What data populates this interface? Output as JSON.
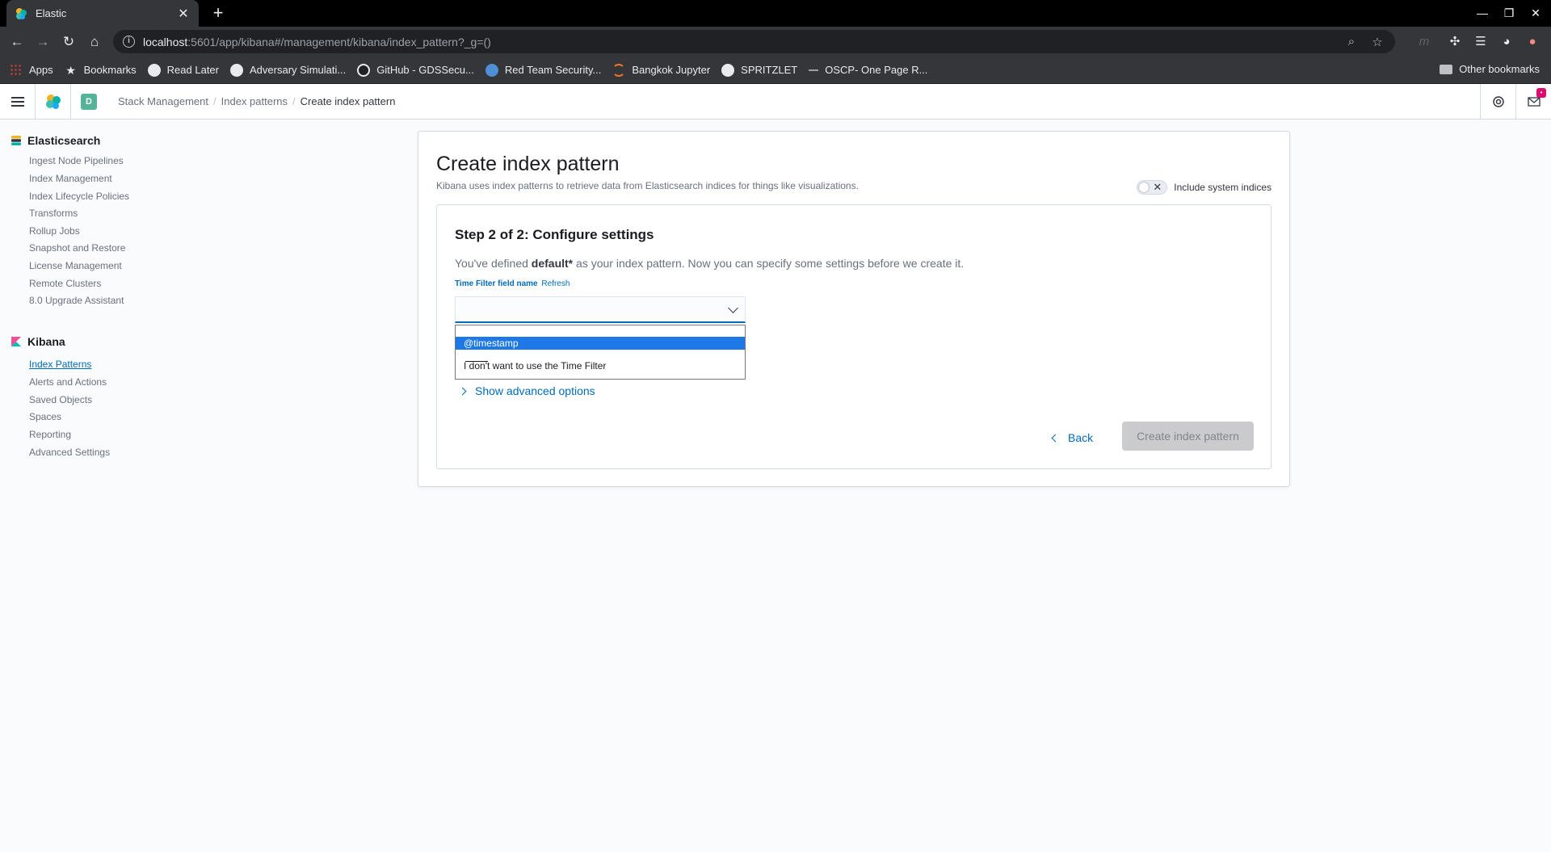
{
  "browser": {
    "tab_title": "Elastic",
    "url_host": "localhost",
    "url_rest": ":5601/app/kibana#/management/kibana/index_pattern?_g=()",
    "bookmarks": [
      {
        "label": "Apps",
        "icon": "apps-grid-icon"
      },
      {
        "label": "Bookmarks",
        "icon": "star-icon"
      },
      {
        "label": "Read Later",
        "icon": "globe-icon"
      },
      {
        "label": "Adversary Simulati...",
        "icon": "globe-icon"
      },
      {
        "label": "GitHub - GDSSecu...",
        "icon": "github-icon"
      },
      {
        "label": "Red Team Security...",
        "icon": "globe-icon"
      },
      {
        "label": "Bangkok Jupyter",
        "icon": "jupyter-icon"
      },
      {
        "label": "SPRITZLET",
        "icon": "globe-icon"
      },
      {
        "label": "OSCP- One Page R...",
        "icon": "dash-icon"
      }
    ],
    "other_bookmarks": "Other bookmarks"
  },
  "header": {
    "space_initial": "D",
    "breadcrumbs": [
      "Stack Management",
      "Index patterns",
      "Create index pattern"
    ],
    "notification_badge": "•"
  },
  "sidebar": {
    "elasticsearch": {
      "title": "Elasticsearch",
      "items": [
        "Ingest Node Pipelines",
        "Index Management",
        "Index Lifecycle Policies",
        "Transforms",
        "Rollup Jobs",
        "Snapshot and Restore",
        "License Management",
        "Remote Clusters",
        "8.0 Upgrade Assistant"
      ]
    },
    "kibana": {
      "title": "Kibana",
      "items": [
        "Index Patterns",
        "Alerts and Actions",
        "Saved Objects",
        "Spaces",
        "Reporting",
        "Advanced Settings"
      ],
      "active": "Index Patterns"
    }
  },
  "main": {
    "title": "Create index pattern",
    "subtitle": "Kibana uses index patterns to retrieve data from Elasticsearch indices for things like visualizations.",
    "system_indices_label": "Include system indices",
    "step_title": "Step 2 of 2: Configure settings",
    "step_desc_pre": "You've defined ",
    "step_desc_pattern": "default*",
    "step_desc_post": " as your index pattern. Now you can specify some settings before we create it.",
    "field_label": "Time Filter field name",
    "refresh_label": "Refresh",
    "select_value": "",
    "options": [
      "@timestamp",
      "———",
      "I don't want to use the Time Filter"
    ],
    "advanced_label": "Show advanced options",
    "back_label": "Back",
    "create_label": "Create index pattern"
  },
  "colors": {
    "accent": "#006bb8",
    "highlight": "#1e78e6",
    "badge": "#dd0a73"
  }
}
